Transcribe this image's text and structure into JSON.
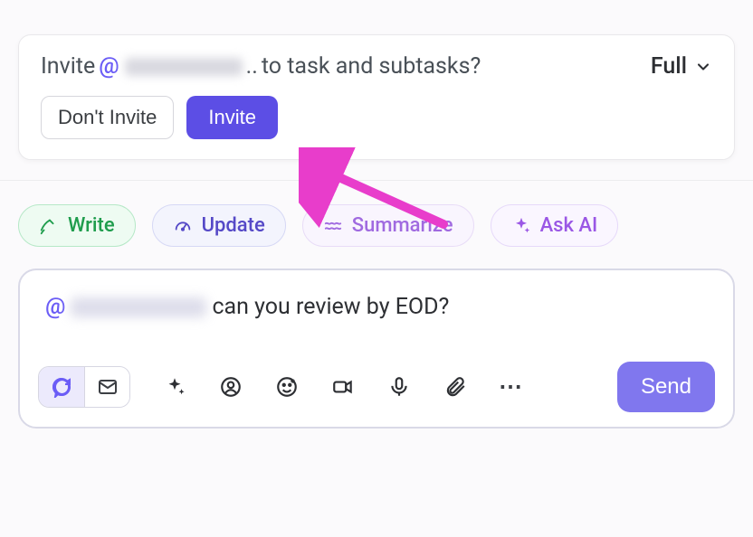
{
  "invite": {
    "prompt_prefix": "Invite ",
    "mention_at": "@",
    "prompt_truncate": "..",
    "prompt_suffix": " to task and subtasks?",
    "scope_label": "Full",
    "dont_invite_label": "Don't Invite",
    "invite_label": "Invite"
  },
  "pills": {
    "write": "Write",
    "update": "Update",
    "summarize": "Summarize",
    "ask_ai": "Ask AI"
  },
  "composer": {
    "mention_at": "@",
    "message_text": " can you review by EOD?",
    "send_label": "Send",
    "more": "⋯"
  }
}
